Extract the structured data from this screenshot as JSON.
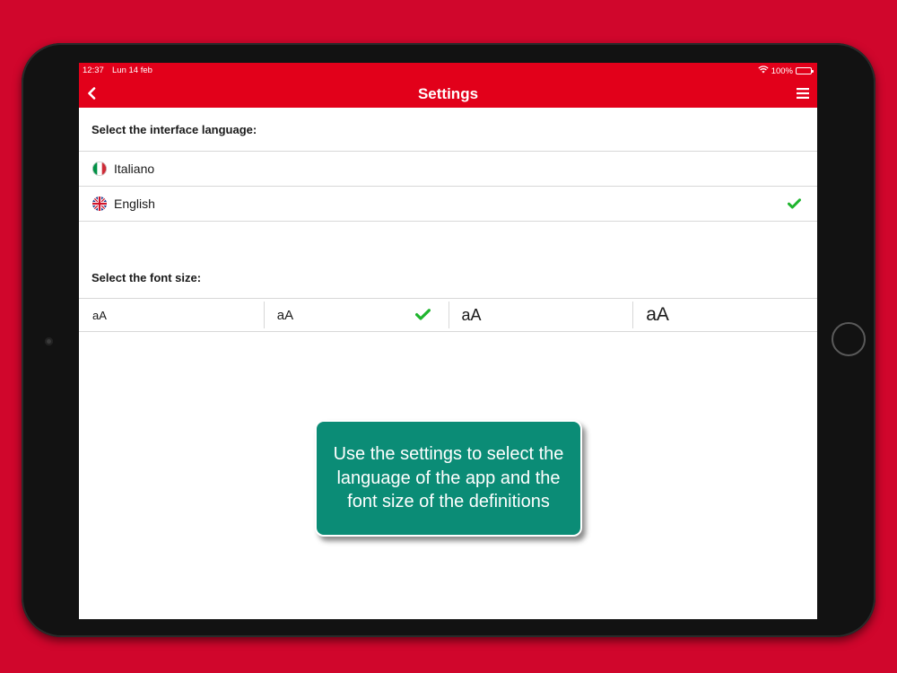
{
  "status_bar": {
    "time": "12:37",
    "date": "Lun 14 feb",
    "battery": "100%",
    "wifi_icon": "wifi-icon",
    "battery_icon": "battery-icon"
  },
  "header": {
    "title": "Settings",
    "back_icon": "chevron-left-icon",
    "menu_icon": "hamburger-menu-icon",
    "background_color": "#e2001a"
  },
  "language_section": {
    "label": "Select the interface language:",
    "options": [
      {
        "label": "Italiano",
        "flag": "italy-flag-icon",
        "selected": false
      },
      {
        "label": "English",
        "flag": "uk-flag-icon",
        "selected": true
      }
    ]
  },
  "font_section": {
    "label": "Select the font size:",
    "options": [
      {
        "label": "aA",
        "selected": false
      },
      {
        "label": "aA",
        "selected": true
      },
      {
        "label": "aA",
        "selected": false
      },
      {
        "label": "aA",
        "selected": false
      }
    ]
  },
  "tooltip": {
    "text": "Use the settings to select the language of the app and the font size of the definitions",
    "background_color": "#0b8c76"
  },
  "colors": {
    "page_background": "#d0062c",
    "check_color": "#1fb52e"
  }
}
